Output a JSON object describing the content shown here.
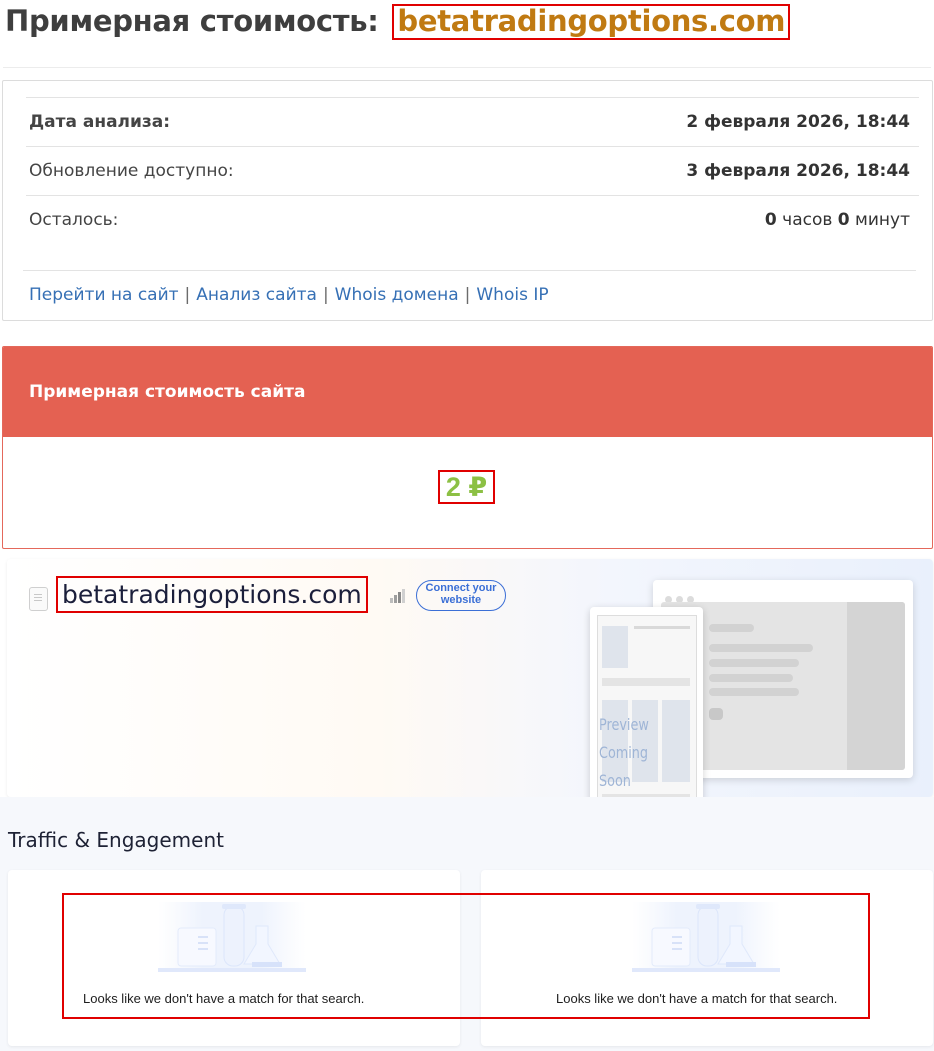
{
  "page": {
    "title_prefix": "Примерная стоимость:",
    "domain": "betatradingoptions.com"
  },
  "info": {
    "rows": [
      {
        "label": "Дата анализа:",
        "value": "2 февраля 2026, 18:44"
      },
      {
        "label": "Обновление доступно:",
        "value": "3 февраля 2026, 18:44"
      },
      {
        "label": "Осталось:",
        "hours_num": "0",
        "hours_unit": "часов",
        "minutes_num": "0",
        "minutes_unit": "минут"
      }
    ],
    "links": [
      "Перейти на сайт",
      "Анализ сайта",
      "Whois домена",
      "Whois IP"
    ],
    "separator": "|"
  },
  "cost": {
    "header": "Примерная стоимость сайта",
    "value": "2 ₽"
  },
  "site_card": {
    "domain": "betatradingoptions.com",
    "connect_button": "Connect your website",
    "preview_line1": "Preview",
    "preview_line2": "Coming Soon"
  },
  "traffic": {
    "title": "Traffic & Engagement",
    "cards": [
      {
        "message": "Looks like we don't have a match for that search."
      },
      {
        "message": "Looks like we don't have a match for that search."
      }
    ]
  },
  "colors": {
    "domain_title": "#c07a12",
    "cost_header_bg": "#e46152",
    "cost_value": "#8cc044",
    "link": "#3670b5",
    "connect": "#3b6fd6",
    "highlight_box": "#e00000"
  }
}
